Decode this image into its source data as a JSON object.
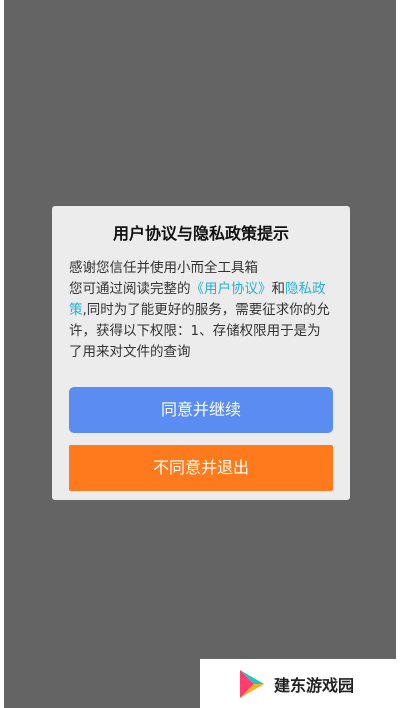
{
  "dialog": {
    "title": "用户协议与隐私政策提示",
    "line1": "感谢您信任并使用小而全工具箱",
    "body_prefix": "您可通过阅读完整的",
    "user_agreement_link": "《用户协议》",
    "and_text": "和",
    "privacy_policy_link": "隐私政策",
    "body_suffix": ",同时为了能更好的服务，需要征求你的允许，获得以下权限：1、存储权限用于是为了用来对文件的查询",
    "agree_button": "同意并继续",
    "disagree_button": "不同意并退出"
  },
  "watermark": {
    "text": "建东游戏园"
  },
  "colors": {
    "overlay": "#646464",
    "dialog_bg": "#ececec",
    "link": "#2ab0d8",
    "agree": "#5a8cf2",
    "disagree": "#ff7a1c"
  }
}
